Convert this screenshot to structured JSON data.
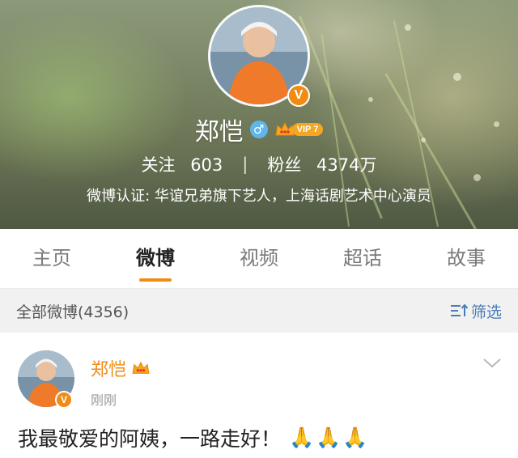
{
  "profile": {
    "name": "郑恺",
    "vip_label": "VIP 7",
    "verified_mark": "V",
    "gender_symbol": "♂",
    "following_label": "关注",
    "following_count": "603",
    "stats_separator": "|",
    "followers_label": "粉丝",
    "followers_count": "4374万",
    "verification": "微博认证: 华谊兄弟旗下艺人，上海话剧艺术中心演员"
  },
  "tabs": [
    {
      "label": "主页",
      "active": false
    },
    {
      "label": "微博",
      "active": true
    },
    {
      "label": "视频",
      "active": false
    },
    {
      "label": "超话",
      "active": false
    },
    {
      "label": "故事",
      "active": false
    }
  ],
  "filter_bar": {
    "label": "全部微博(4356)",
    "filter_label": "筛选"
  },
  "post": {
    "author": "郑恺",
    "time": "刚刚",
    "text": "我最敬爱的阿姨，一路走好！",
    "emoji": [
      "🙏",
      "🙏",
      "🙏"
    ],
    "verified_mark": "V"
  },
  "colors": {
    "accent": "#f08c14",
    "link": "#4a7cb8",
    "gender": "#5fb6ec"
  }
}
